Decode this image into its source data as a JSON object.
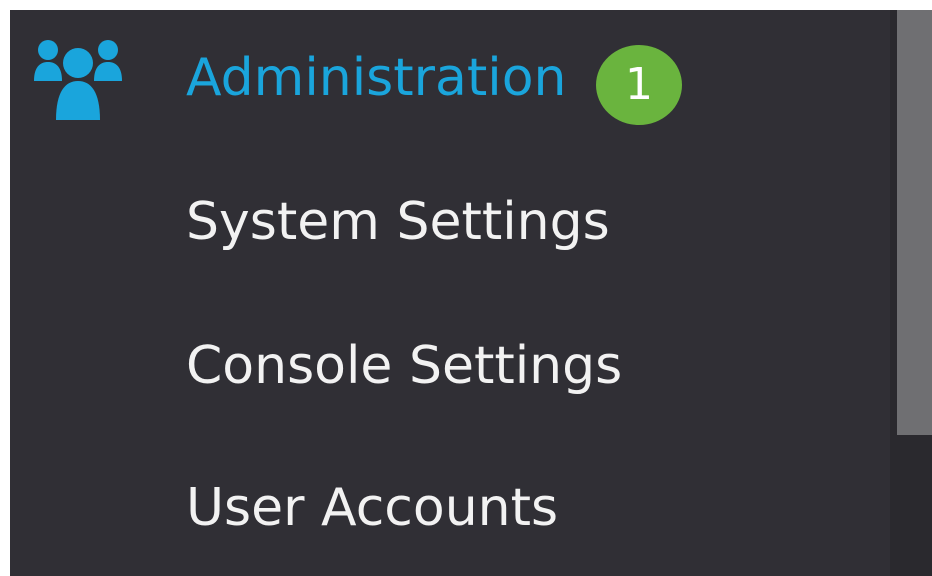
{
  "sidebar": {
    "section": {
      "label": "Administration",
      "icon": "users-group-icon",
      "active_color": "#1aa5dc"
    },
    "items": [
      {
        "label": "System Settings"
      },
      {
        "label": "Console Settings"
      },
      {
        "label": "User Accounts"
      }
    ]
  },
  "annotation": {
    "badge_number": "1",
    "badge_color": "#6ab43e"
  },
  "colors": {
    "sidebar_background": "#302f35",
    "text": "#f2f2f2"
  }
}
